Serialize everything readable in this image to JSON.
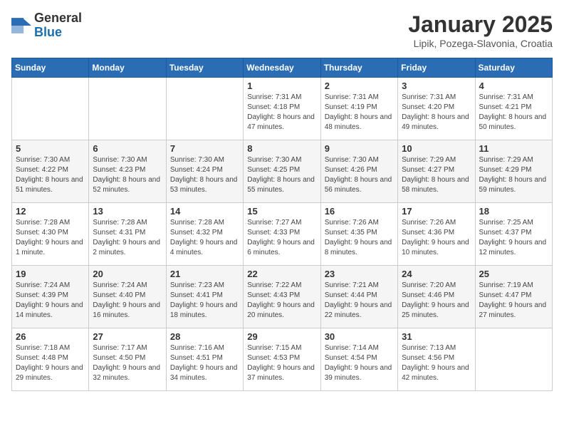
{
  "header": {
    "logo_general": "General",
    "logo_blue": "Blue",
    "title": "January 2025",
    "location": "Lipik, Pozega-Slavonia, Croatia"
  },
  "weekdays": [
    "Sunday",
    "Monday",
    "Tuesday",
    "Wednesday",
    "Thursday",
    "Friday",
    "Saturday"
  ],
  "weeks": [
    [
      {
        "day": "",
        "info": ""
      },
      {
        "day": "",
        "info": ""
      },
      {
        "day": "",
        "info": ""
      },
      {
        "day": "1",
        "info": "Sunrise: 7:31 AM\nSunset: 4:18 PM\nDaylight: 8 hours and 47 minutes."
      },
      {
        "day": "2",
        "info": "Sunrise: 7:31 AM\nSunset: 4:19 PM\nDaylight: 8 hours and 48 minutes."
      },
      {
        "day": "3",
        "info": "Sunrise: 7:31 AM\nSunset: 4:20 PM\nDaylight: 8 hours and 49 minutes."
      },
      {
        "day": "4",
        "info": "Sunrise: 7:31 AM\nSunset: 4:21 PM\nDaylight: 8 hours and 50 minutes."
      }
    ],
    [
      {
        "day": "5",
        "info": "Sunrise: 7:30 AM\nSunset: 4:22 PM\nDaylight: 8 hours and 51 minutes."
      },
      {
        "day": "6",
        "info": "Sunrise: 7:30 AM\nSunset: 4:23 PM\nDaylight: 8 hours and 52 minutes."
      },
      {
        "day": "7",
        "info": "Sunrise: 7:30 AM\nSunset: 4:24 PM\nDaylight: 8 hours and 53 minutes."
      },
      {
        "day": "8",
        "info": "Sunrise: 7:30 AM\nSunset: 4:25 PM\nDaylight: 8 hours and 55 minutes."
      },
      {
        "day": "9",
        "info": "Sunrise: 7:30 AM\nSunset: 4:26 PM\nDaylight: 8 hours and 56 minutes."
      },
      {
        "day": "10",
        "info": "Sunrise: 7:29 AM\nSunset: 4:27 PM\nDaylight: 8 hours and 58 minutes."
      },
      {
        "day": "11",
        "info": "Sunrise: 7:29 AM\nSunset: 4:29 PM\nDaylight: 8 hours and 59 minutes."
      }
    ],
    [
      {
        "day": "12",
        "info": "Sunrise: 7:28 AM\nSunset: 4:30 PM\nDaylight: 9 hours and 1 minute."
      },
      {
        "day": "13",
        "info": "Sunrise: 7:28 AM\nSunset: 4:31 PM\nDaylight: 9 hours and 2 minutes."
      },
      {
        "day": "14",
        "info": "Sunrise: 7:28 AM\nSunset: 4:32 PM\nDaylight: 9 hours and 4 minutes."
      },
      {
        "day": "15",
        "info": "Sunrise: 7:27 AM\nSunset: 4:33 PM\nDaylight: 9 hours and 6 minutes."
      },
      {
        "day": "16",
        "info": "Sunrise: 7:26 AM\nSunset: 4:35 PM\nDaylight: 9 hours and 8 minutes."
      },
      {
        "day": "17",
        "info": "Sunrise: 7:26 AM\nSunset: 4:36 PM\nDaylight: 9 hours and 10 minutes."
      },
      {
        "day": "18",
        "info": "Sunrise: 7:25 AM\nSunset: 4:37 PM\nDaylight: 9 hours and 12 minutes."
      }
    ],
    [
      {
        "day": "19",
        "info": "Sunrise: 7:24 AM\nSunset: 4:39 PM\nDaylight: 9 hours and 14 minutes."
      },
      {
        "day": "20",
        "info": "Sunrise: 7:24 AM\nSunset: 4:40 PM\nDaylight: 9 hours and 16 minutes."
      },
      {
        "day": "21",
        "info": "Sunrise: 7:23 AM\nSunset: 4:41 PM\nDaylight: 9 hours and 18 minutes."
      },
      {
        "day": "22",
        "info": "Sunrise: 7:22 AM\nSunset: 4:43 PM\nDaylight: 9 hours and 20 minutes."
      },
      {
        "day": "23",
        "info": "Sunrise: 7:21 AM\nSunset: 4:44 PM\nDaylight: 9 hours and 22 minutes."
      },
      {
        "day": "24",
        "info": "Sunrise: 7:20 AM\nSunset: 4:46 PM\nDaylight: 9 hours and 25 minutes."
      },
      {
        "day": "25",
        "info": "Sunrise: 7:19 AM\nSunset: 4:47 PM\nDaylight: 9 hours and 27 minutes."
      }
    ],
    [
      {
        "day": "26",
        "info": "Sunrise: 7:18 AM\nSunset: 4:48 PM\nDaylight: 9 hours and 29 minutes."
      },
      {
        "day": "27",
        "info": "Sunrise: 7:17 AM\nSunset: 4:50 PM\nDaylight: 9 hours and 32 minutes."
      },
      {
        "day": "28",
        "info": "Sunrise: 7:16 AM\nSunset: 4:51 PM\nDaylight: 9 hours and 34 minutes."
      },
      {
        "day": "29",
        "info": "Sunrise: 7:15 AM\nSunset: 4:53 PM\nDaylight: 9 hours and 37 minutes."
      },
      {
        "day": "30",
        "info": "Sunrise: 7:14 AM\nSunset: 4:54 PM\nDaylight: 9 hours and 39 minutes."
      },
      {
        "day": "31",
        "info": "Sunrise: 7:13 AM\nSunset: 4:56 PM\nDaylight: 9 hours and 42 minutes."
      },
      {
        "day": "",
        "info": ""
      }
    ]
  ]
}
